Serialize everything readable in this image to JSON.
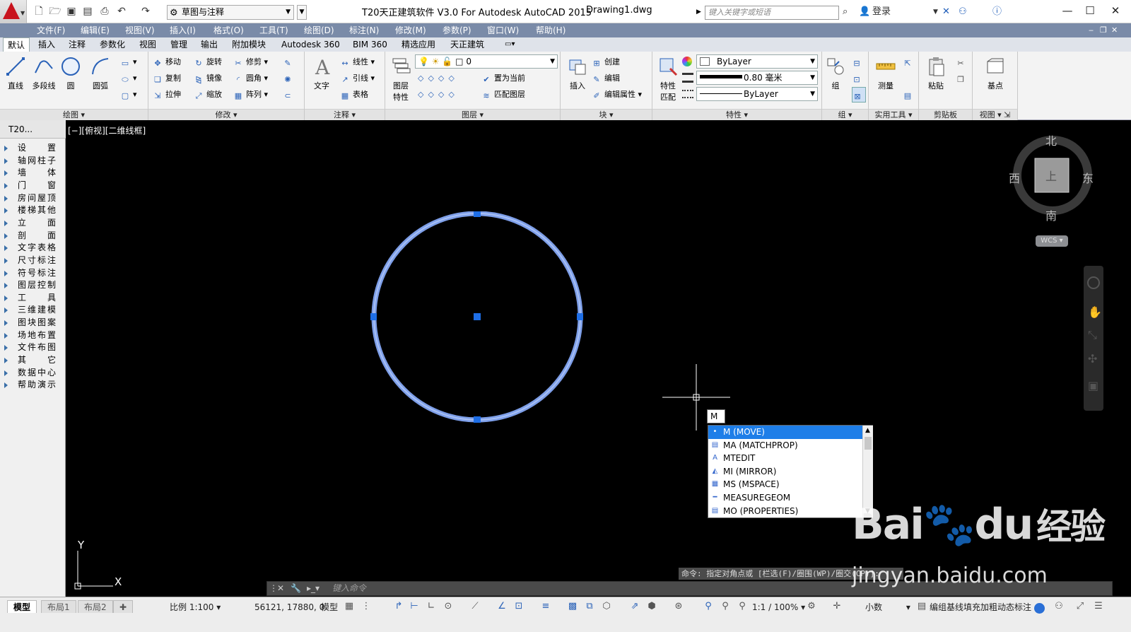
{
  "titlebar": {
    "workspace": "草图与注释",
    "app_title": "T20天正建筑软件 V3.0 For Autodesk AutoCAD 2015",
    "document": "Drawing1.dwg",
    "search_placeholder": "键入关键字或短语",
    "login": "登录"
  },
  "menus": [
    "文件(F)",
    "编辑(E)",
    "视图(V)",
    "插入(I)",
    "格式(O)",
    "工具(T)",
    "绘图(D)",
    "标注(N)",
    "修改(M)",
    "参数(P)",
    "窗口(W)",
    "帮助(H)"
  ],
  "tabs": [
    "默认",
    "插入",
    "注释",
    "参数化",
    "视图",
    "管理",
    "输出",
    "附加模块",
    "Autodesk 360",
    "BIM 360",
    "精选应用",
    "天正建筑"
  ],
  "ribbon": {
    "draw": {
      "title": "绘图",
      "line": "直线",
      "polyline": "多段线",
      "circle": "圆",
      "arc": "圆弧"
    },
    "modify": {
      "title": "修改",
      "move": "移动",
      "rotate": "旋转",
      "trim": "修剪",
      "copy": "复制",
      "mirror": "镜像",
      "fillet": "圆角",
      "stretch": "拉伸",
      "scale": "缩放",
      "array": "阵列"
    },
    "annotation": {
      "title": "注释",
      "text": "文字",
      "linear": "线性",
      "leader": "引线",
      "table": "表格"
    },
    "layers": {
      "title": "图层",
      "properties_line1": "图层",
      "properties_line2": "特性",
      "current_layer": "0",
      "set_current": "置为当前",
      "match_layer": "匹配图层"
    },
    "block": {
      "title": "块",
      "insert": "插入",
      "create": "创建",
      "edit": "编辑",
      "edit_attr": "编辑属性"
    },
    "properties": {
      "title": "特性",
      "match_line1": "特性",
      "match_line2": "匹配",
      "color": "ByLayer",
      "lineweight": "0.80 毫米",
      "linetype": "ByLayer"
    },
    "groups": {
      "title": "组",
      "group": "组"
    },
    "utilities": {
      "title": "实用工具",
      "measure": "测量"
    },
    "clipboard": {
      "title": "剪贴板",
      "paste": "粘贴"
    },
    "view": {
      "title": "视图",
      "base": "基点"
    }
  },
  "sidebar": {
    "title": "T20...",
    "items": [
      "设　置",
      "轴网柱子",
      "墙　体",
      "门　窗",
      "房间屋顶",
      "楼梯其他",
      "立　面",
      "剖　面",
      "文字表格",
      "尺寸标注",
      "符号标注",
      "图层控制",
      "工　具",
      "三维建模",
      "图块图案",
      "场地布置",
      "文件布图",
      "其　它",
      "数据中心",
      "帮助演示"
    ]
  },
  "viewport": {
    "label": "[−][俯视][二维线框]",
    "command_input": "M",
    "autocomplete": [
      "M (MOVE)",
      "MA (MATCHPROP)",
      "MTEDIT",
      "MI (MIRROR)",
      "MS (MSPACE)",
      "MEASUREGEOM",
      "MO (PROPERTIES)"
    ],
    "compass": {
      "n": "北",
      "s": "南",
      "e": "东",
      "w": "西",
      "top": "上"
    },
    "wcs": "WCS",
    "ucs_x": "X",
    "ucs_y": "Y",
    "command_history": "命令: 指定对角点或 [栏选(F)/圈围(WP)/圈交(CP)]:",
    "command_placeholder": "键入命令"
  },
  "statusbar": {
    "layouts": [
      "模型",
      "布局1",
      "布局2"
    ],
    "scale": "比例 1:100",
    "coords": "56121, 17880, 0",
    "model": "模型",
    "anno_scale": "1:1 / 100%",
    "units": "小数",
    "tianzheng": "编组基线填充加粗动态标注"
  },
  "watermark": {
    "brand": "Bai",
    "du": "du",
    "cn": "经验",
    "url": "jingyan.baidu.com"
  }
}
